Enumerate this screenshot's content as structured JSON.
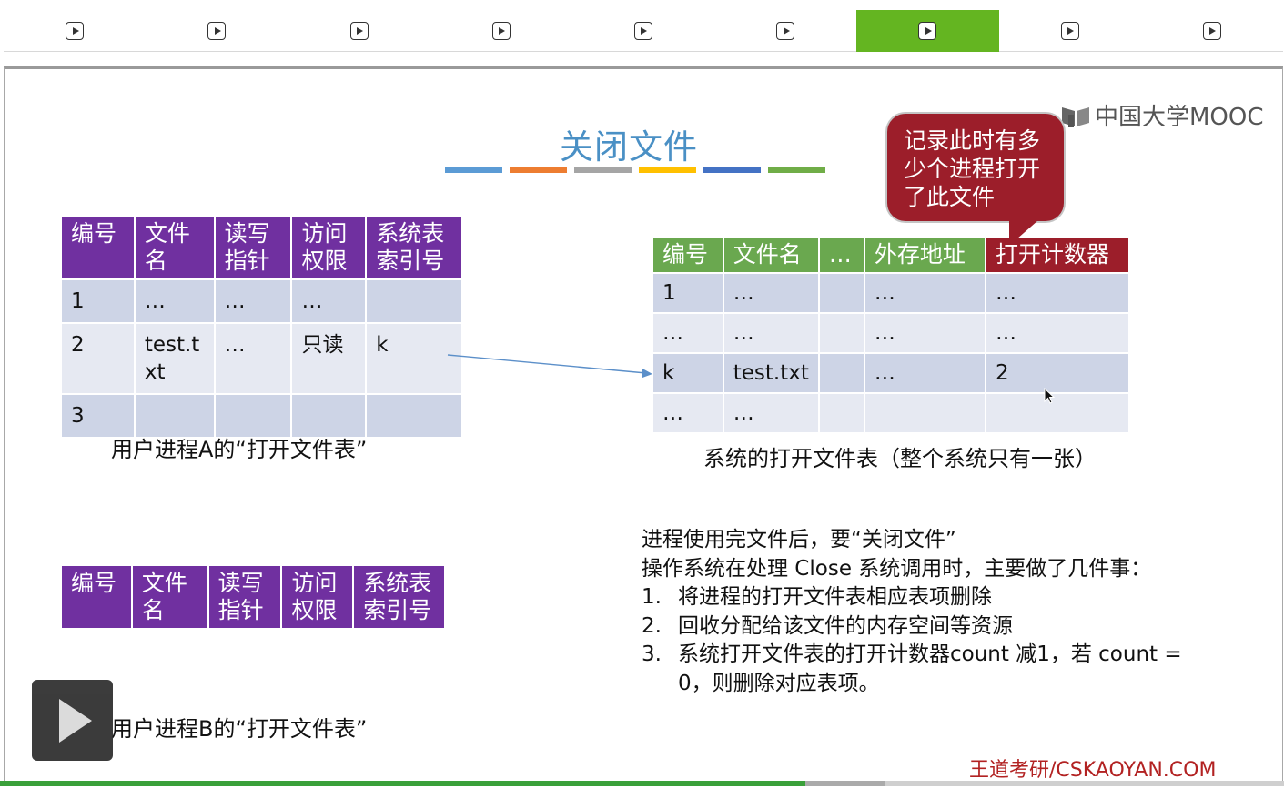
{
  "nav": {
    "segments": 9,
    "active_index": 6,
    "active_color": "#64b521",
    "icon": "play-square-icon"
  },
  "slide": {
    "title": "关闭文件",
    "title_rule_colors": [
      "#5b9bd5",
      "#ed7d31",
      "#a5a5a5",
      "#ffc000",
      "#4472c4",
      "#70ad47"
    ],
    "logo_text": "中国大学MOOC",
    "callout": [
      "记录此时有多",
      "少个进程打开",
      "了此文件"
    ],
    "tableA": {
      "headers": [
        [
          "编号"
        ],
        [
          "文件",
          "名"
        ],
        [
          "读写",
          "指针"
        ],
        [
          "访问",
          "权限"
        ],
        [
          "系统表",
          "索引号"
        ]
      ],
      "rows": [
        [
          "1",
          "…",
          "…",
          "…",
          ""
        ],
        [
          "2",
          "test.txt",
          "…",
          "只读",
          "k"
        ],
        [
          "3",
          "",
          "",
          "",
          ""
        ]
      ],
      "caption": "用户进程A的“打开文件表”"
    },
    "tableB": {
      "headers": [
        [
          "编号"
        ],
        [
          "文件",
          "名"
        ],
        [
          "读写",
          "指针"
        ],
        [
          "访问",
          "权限"
        ],
        [
          "系统表",
          "索引号"
        ]
      ],
      "caption": "用户进程B的“打开文件表”"
    },
    "systemTable": {
      "headers": [
        "编号",
        "文件名",
        "…",
        "外存地址",
        "打开计数器"
      ],
      "rows": [
        [
          "1",
          "…",
          "",
          "…",
          "…"
        ],
        [
          "…",
          "…",
          "",
          "…",
          "…"
        ],
        [
          "k",
          "test.txt",
          "",
          "…",
          "2"
        ],
        [
          "…",
          "…",
          "",
          "",
          ""
        ]
      ],
      "caption": "系统的打开文件表（整个系统只有一张）"
    },
    "description": {
      "line1": "进程使用完文件后，要“关闭文件”",
      "line2": "操作系统在处理 Close 系统调用时，主要做了几件事：",
      "items": [
        {
          "num": "1.",
          "text": "将进程的打开文件表相应表项删除"
        },
        {
          "num": "2.",
          "text": "回收分配给该文件的内存空间等资源"
        },
        {
          "num": "3.",
          "text": "系统打开文件表的打开计数器count 减1，若 count =",
          "text2": "0，则删除对应表项。"
        }
      ]
    },
    "watermark": "王道考研/CSKAOYAN.COM"
  },
  "player": {
    "play_icon": "play-icon",
    "progress_fraction": 0.627
  }
}
